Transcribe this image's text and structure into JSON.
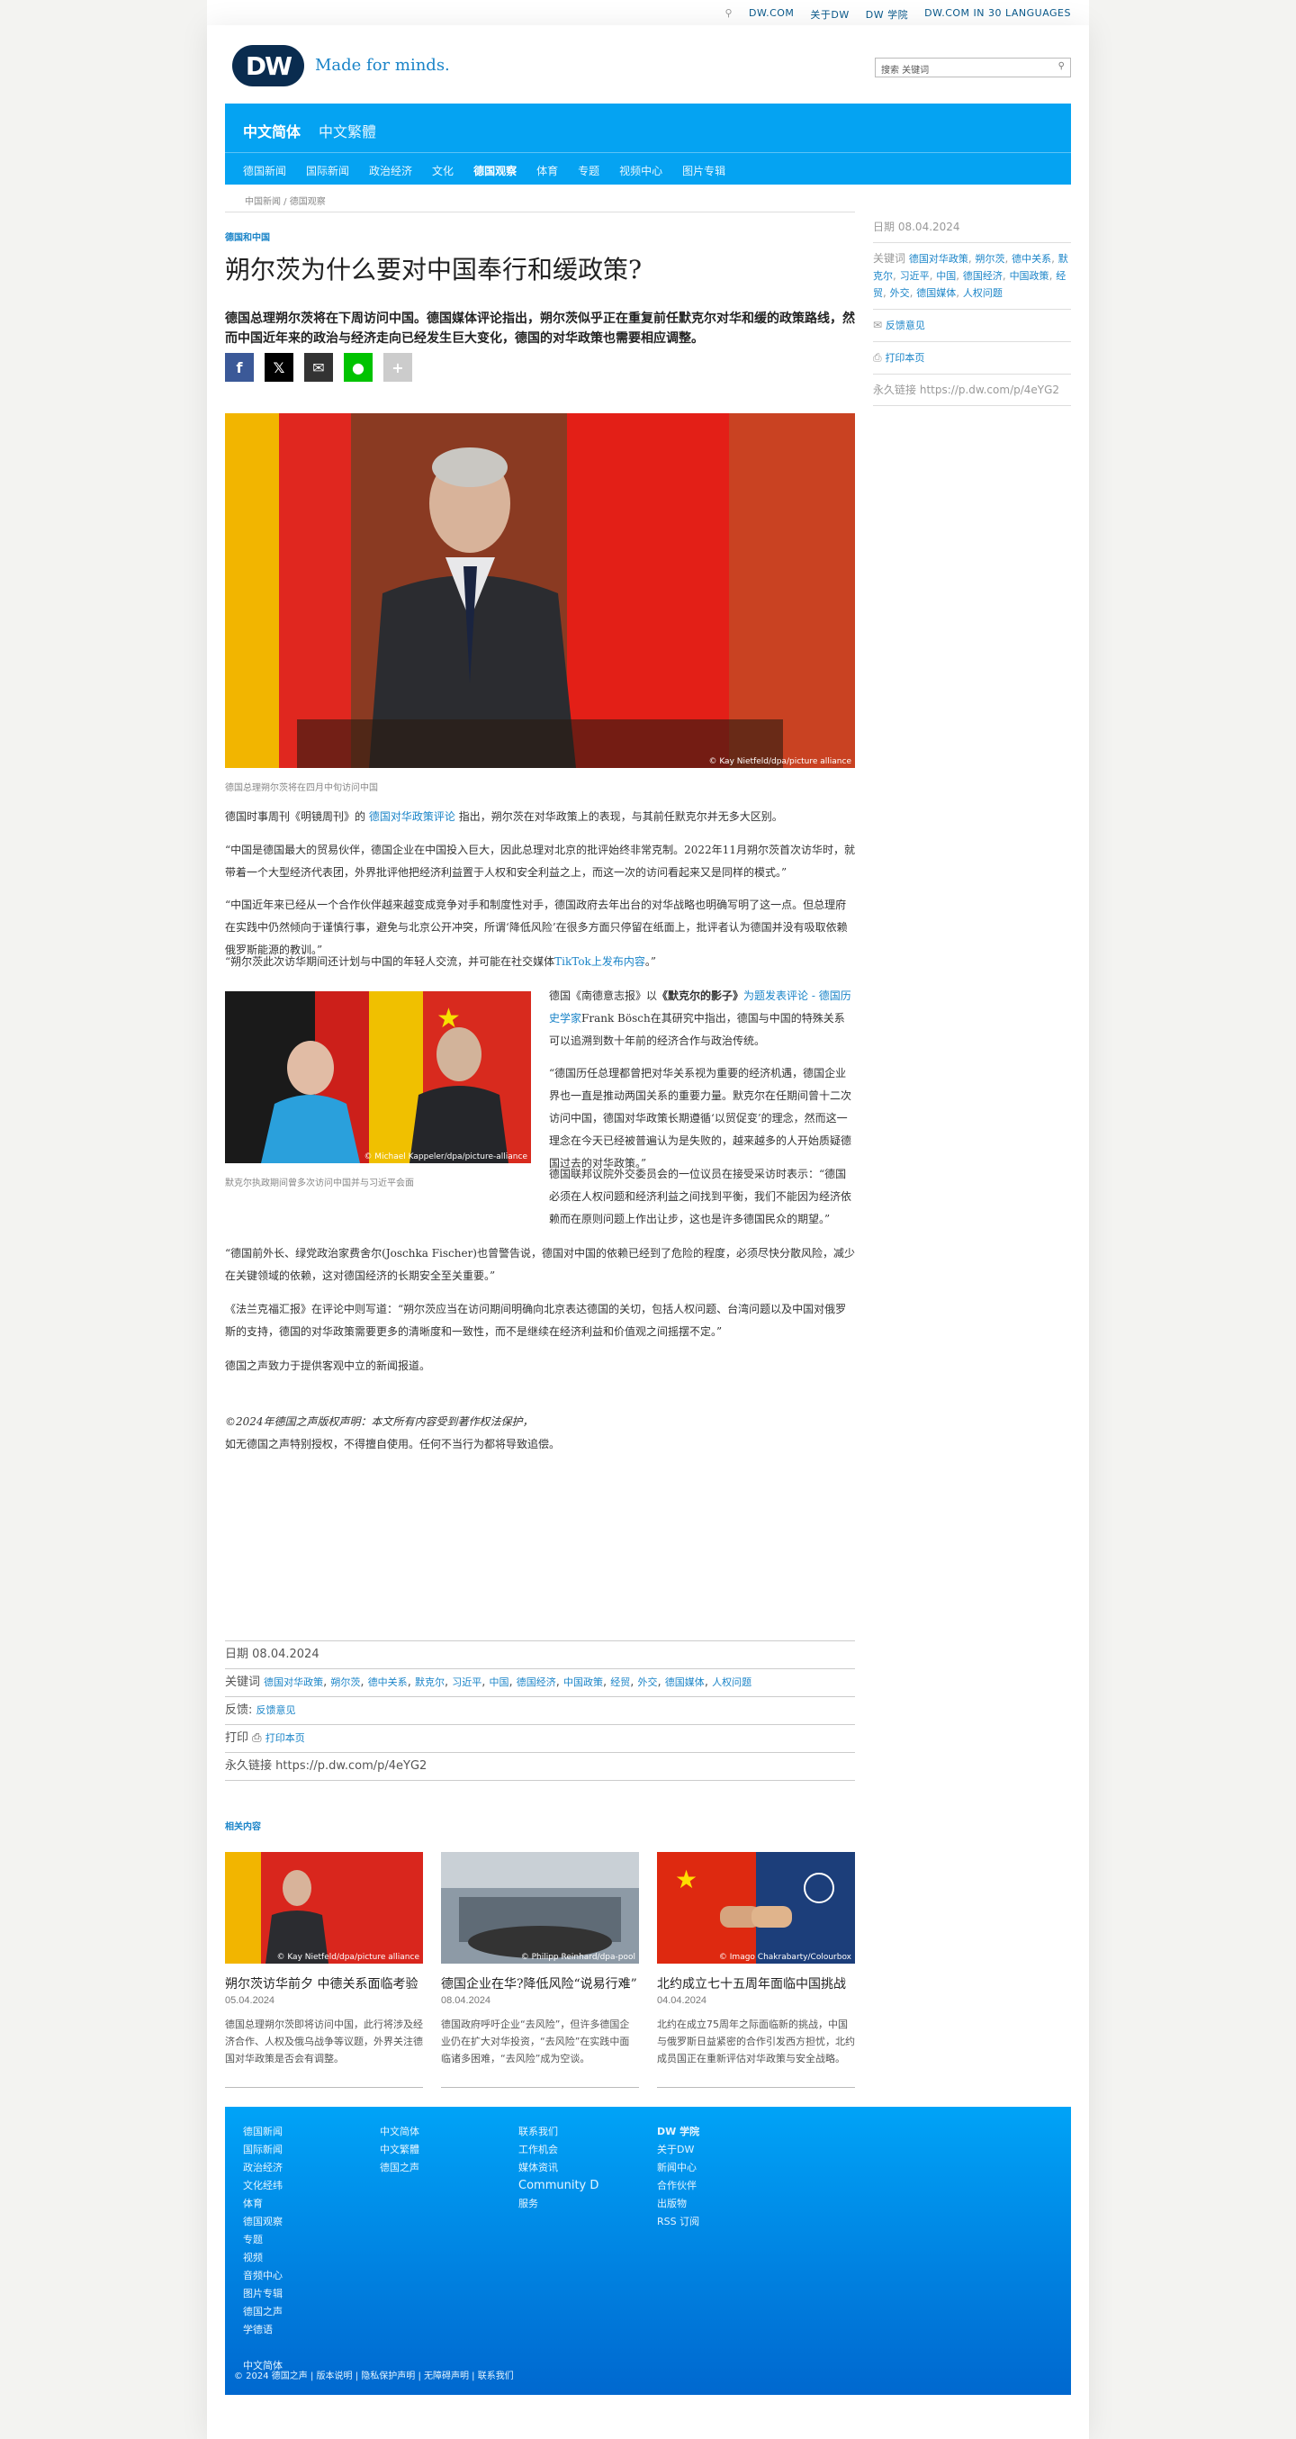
{
  "topbar": {
    "links": [
      "DW.COM",
      "关于DW",
      "DW 学院",
      "DW.COM IN 30 LANGUAGES"
    ]
  },
  "header": {
    "logo": "DW",
    "tagline": "Made for minds.",
    "search_placeholder": "搜索 关键词"
  },
  "nav": {
    "main": [
      "中文简体",
      "中文繁體"
    ],
    "sub": [
      "德国新闻",
      "国际新闻",
      "政治经济",
      "文化",
      "德国观察",
      "体育",
      "专题",
      "视频中心",
      "图片专辑"
    ]
  },
  "breadcrumb": "中国新闻 / 德国观察",
  "article": {
    "kicker": "德国和中国",
    "title": "朔尔茨为什么要对中国奉行和缓政策?",
    "lead": "德国总理朔尔茨将在下周访问中国。德国媒体评论指出，朔尔茨似乎正在重复前任默克尔对华和缓的政策路线，然而中国近年来的政治与经济走向已经发生巨大变化，德国的对华政策也需要相应调整。",
    "hero_caption": "德国总理朔尔茨将在四月中旬访问中国",
    "hero_credit": "© Kay Nietfeld/dpa/picture alliance",
    "p1_pre": "德国时事周刊《明镜周刊》的",
    "p1_link": "德国对华政策评论",
    "p1_post": "指出，朔尔茨在对华政策上的表现，与其前任默克尔并无多大区别。",
    "p2": "“中国是德国最大的贸易伙伴，德国企业在中国投入巨大，因此总理对北京的批评始终非常克制。2022年11月朔尔茨首次访华时，就带着一个大型经济代表团，外界批评他把经济利益置于人权和安全利益之上，而这一次的访问看起来又是同样的模式。”",
    "p3": "“中国近年来已经从一个合作伙伴越来越变成竞争对手和制度性对手，德国政府去年出台的对华战略也明确写明了这一点。但总理府在实践中仍然倾向于谨慎行事，避免与北京公开冲突，所谓‘降低风险’在很多方面只停留在纸面上，批评者认为德国并没有吸取依赖俄罗斯能源的教训。”",
    "p4_pre": "“朔尔茨此次访华期间还计划与中国的年轻人交流，并可能在社交媒体",
    "p4_link": "TikTok上发布内容",
    "p4_post": "。”",
    "inline_caption": "默克尔执政期间曾多次访问中国并与习近平会面",
    "inline_credit": "© Michael Kappeler/dpa/picture-alliance",
    "p5_pre": "德国《南德意志报》以",
    "p5_quote": "《默克尔的影子》",
    "p5_link": "为题发表评论 - 德国历史学家",
    "p5_post": "Frank Bösch在其研究中指出，德国与中国的特殊关系可以追溯到数十年前的经济合作与政治传统。",
    "p6": "“德国历任总理都曾把对华关系视为重要的经济机遇，德国企业界也一直是推动两国关系的重要力量。默克尔在任期间曾十二次访问中国，德国对华政策长期遵循‘以贸促变’的理念，然而这一理念在今天已经被普遍认为是失败的，越来越多的人开始质疑德国过去的对华政策。”",
    "p7": "德国联邦议院外交委员会的一位议员在接受采访时表示：“德国必须在人权问题和经济利益之间找到平衡，我们不能因为经济依赖而在原则问题上作出让步，这也是许多德国民众的期望。”",
    "p8": "“德国前外长、绿党政治家费舍尔(Joschka Fischer)也曾警告说，德国对中国的依赖已经到了危险的程度，必须尽快分散风险，减少在关键领域的依赖，这对德国经济的长期安全至关重要。”",
    "p9": "《法兰克福汇报》在评论中则写道：“朔尔茨应当在访问期间明确向北京表达德国的关切，包括人权问题、台湾问题以及中国对俄罗斯的支持，德国的对华政策需要更多的清晰度和一致性，而不是继续在经济利益和价值观之间摇摆不定。”",
    "p10": "德国之声致力于提供客观中立的新闻报道。",
    "copyright_1": "©2024年德国之声版权声明：本文所有内容受到著作权法保护，",
    "copyright_2": "如无德国之声特别授权，不得擅自使用。任何不当行为都将导致追偿。"
  },
  "sidebar": {
    "date_label": "日期",
    "date": "08.04.2024",
    "tags_label": "关键词",
    "tags": [
      "德国对华政策",
      "朔尔茨",
      "德中关系",
      "默克尔",
      "习近平",
      "中国",
      "德国经济",
      "中国政策",
      "经贸",
      "外交",
      "德国媒体",
      "人权问题"
    ],
    "feedback": "反馈意见",
    "print": "打印本页",
    "permalink_label": "永久链接",
    "permalink": "https://p.dw.com/p/4eYG2"
  },
  "meta": {
    "date_label": "日期",
    "date": "08.04.2024",
    "tags_label": "关键词",
    "tags": [
      "德国对华政策",
      "朔尔茨",
      "德中关系",
      "默克尔",
      "习近平",
      "中国",
      "德国经济",
      "中国政策",
      "经贸",
      "外交",
      "德国媒体",
      "人权问题"
    ],
    "feedback_label": "反馈",
    "feedback": "反馈意见",
    "print_label": "打印",
    "print": "打印本页",
    "permalink_label": "永久链接",
    "permalink": "https://p.dw.com/p/4eYG2"
  },
  "related": {
    "label": "相关内容",
    "cards": [
      {
        "title": "朔尔茨访华前夕 中德关系面临考验",
        "date": "05.04.2024",
        "text": "德国总理朔尔茨即将访问中国，此行将涉及经济合作、人权及俄乌战争等议题，外界关注德国对华政策是否会有调整。",
        "credit": "© Kay Nietfeld/dpa/picture alliance"
      },
      {
        "title": "德国企业在华?降低风险“说易行难”",
        "date": "08.04.2024",
        "text": "德国政府呼吁企业“去风险”，但许多德国企业仍在扩大对华投资，“去风险”在实践中面临诸多困难，“去风险”成为空谈。",
        "credit": "© Philipp Reinhard/dpa-pool"
      },
      {
        "title": "北约成立七十五周年面临中国挑战",
        "date": "04.04.2024",
        "text": "北约在成立75周年之际面临新的挑战，中国与俄罗斯日益紧密的合作引发西方担忧，北约成员国正在重新评估对华政策与安全战略。",
        "credit": "© Imago Chakrabarty/Colourbox"
      }
    ]
  },
  "footer": {
    "col1": [
      "德国新闻",
      "国际新闻",
      "政治经济",
      "文化经纬",
      "体育",
      "德国观察",
      "专题",
      "视频",
      "音频中心",
      "图片专辑",
      "德国之声",
      "学德语"
    ],
    "col2": [
      "中文简体",
      "中文繁體",
      "德国之声"
    ],
    "col3": [
      "联系我们",
      "工作机会",
      "媒体资讯",
      "Community D",
      "服务"
    ],
    "col4": [
      "DW 学院",
      "关于DW",
      "新闻中心",
      "合作伙伴",
      "出版物",
      "RSS 订阅"
    ],
    "bottom_extra": "中文简体",
    "copyright": "© 2024 德国之声 | 版本说明 | 隐私保护声明 | 无障碍声明 | 联系我们"
  },
  "colors": {
    "accent": "#05a3f2",
    "link": "#1a84c8",
    "navy": "#0a2c4f"
  }
}
